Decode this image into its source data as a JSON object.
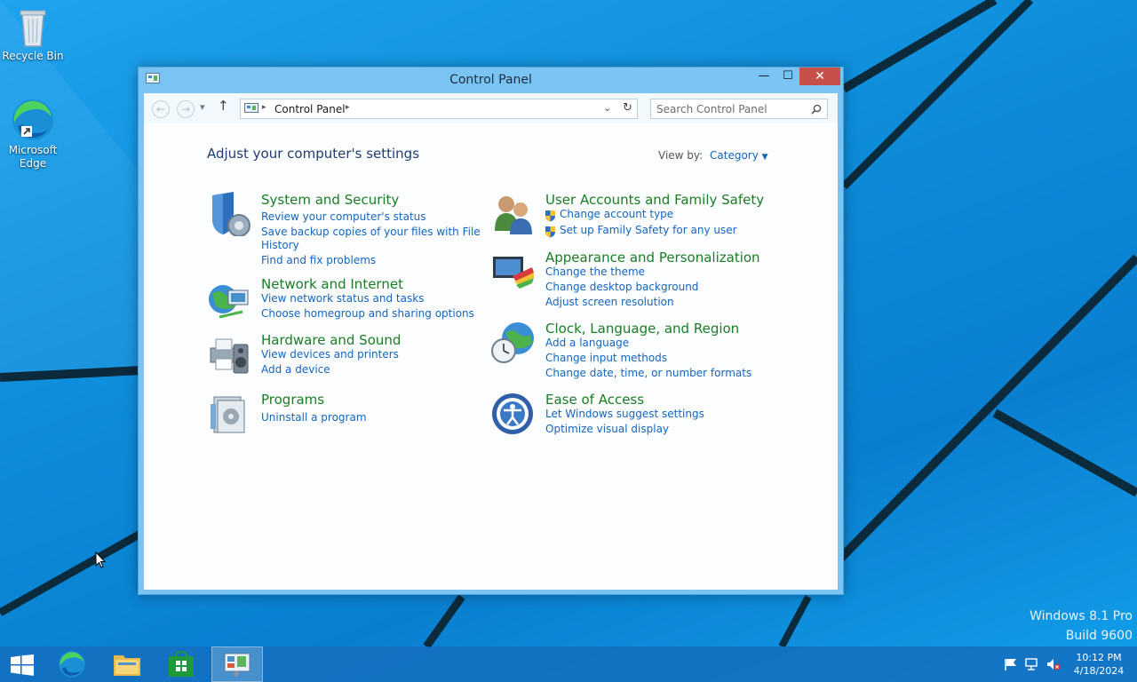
{
  "desktop": {
    "icons": [
      {
        "label": "Recycle Bin",
        "icon": "recycle-bin-icon"
      },
      {
        "label": "Microsoft Edge",
        "icon": "edge-icon"
      }
    ],
    "watermark": {
      "line1": "Windows 8.1 Pro",
      "line2": "Build 9600"
    }
  },
  "window": {
    "title": "Control Panel",
    "controls": {
      "minimize": "—",
      "maximize": "☐",
      "close": "✕"
    },
    "nav": {
      "back": "back-arrow-icon",
      "forward": "forward-arrow-icon",
      "up": "up-arrow-icon",
      "breadcrumb": "Control Panel",
      "refresh": "refresh-icon"
    },
    "search": {
      "placeholder": "Search Control Panel",
      "value": ""
    },
    "heading": "Adjust your computer's settings",
    "view_by": {
      "label": "View by:",
      "value": "Category"
    },
    "categories_left": [
      {
        "title": "System and Security",
        "links": [
          "Review your computer's status",
          "Save backup copies of your files with File",
          "History",
          "Find and fix problems"
        ]
      },
      {
        "title": "Network and Internet",
        "links": [
          "View network status and tasks",
          "Choose homegroup and sharing options"
        ]
      },
      {
        "title": "Hardware and Sound",
        "links": [
          "View devices and printers",
          "Add a device"
        ]
      },
      {
        "title": "Programs",
        "links": [
          "Uninstall a program"
        ]
      }
    ],
    "categories_right": [
      {
        "title": "User Accounts and Family Safety",
        "links": [
          "Change account type",
          "Set up Family Safety for any user"
        ]
      },
      {
        "title": "Appearance and Personalization",
        "links": [
          "Change the theme",
          "Change desktop background",
          "Adjust screen resolution"
        ]
      },
      {
        "title": "Clock, Language, and Region",
        "links": [
          "Add a language",
          "Change input methods",
          "Change date, time, or number formats"
        ]
      },
      {
        "title": "Ease of Access",
        "links": [
          "Let Windows suggest settings",
          "Optimize visual display"
        ]
      }
    ]
  },
  "taskbar": {
    "items": [
      "start-button",
      "edge",
      "file-explorer",
      "store",
      "control-panel"
    ],
    "clock": {
      "time": "10:12 PM",
      "date": "4/18/2024"
    }
  }
}
